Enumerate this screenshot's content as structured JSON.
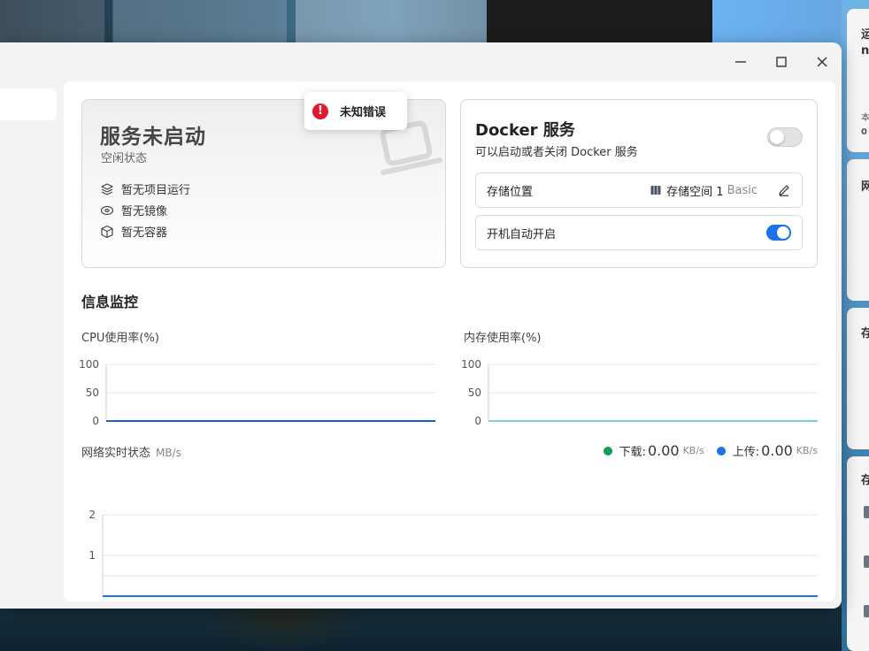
{
  "window": {
    "minimize_icon": "minimize-icon",
    "maximize_icon": "maximize-icon",
    "close_icon": "close-icon"
  },
  "toast": {
    "icon": "error-icon",
    "message": "未知错误",
    "color": "#e2192c"
  },
  "status_card": {
    "title": "服务未启动",
    "subtitle": "空闲状态",
    "items": [
      {
        "icon": "layers-icon",
        "label": "暂无项目运行"
      },
      {
        "icon": "disc-icon",
        "label": "暂无镜像"
      },
      {
        "icon": "box-icon",
        "label": "暂无容器"
      }
    ]
  },
  "docker_card": {
    "title": "Docker 服务",
    "subtitle": "可以启动或者关闭 Docker 服务",
    "service_enabled": false,
    "storage": {
      "label": "存储位置",
      "value": "存储空间 1",
      "tag": "Basic",
      "icon": "storage-icon",
      "edit_icon": "edit-icon"
    },
    "autostart": {
      "label": "开机自动开启",
      "enabled": true
    },
    "accent_color": "#1a73e8"
  },
  "monitor": {
    "title": "信息监控",
    "cpu_label": "CPU使用率(%)",
    "mem_label": "内存使用率(%)",
    "net_label": "网络实时状态",
    "net_unit": "MB/s",
    "download_label": "下载:",
    "download_value": "0.00",
    "download_unit": "KB/s",
    "upload_label": "上传:",
    "upload_value": "0.00",
    "upload_unit": "KB/s",
    "download_color": "#0f9d58",
    "upload_color": "#1a73e8"
  },
  "chart_data": [
    {
      "type": "line",
      "title": "CPU使用率(%)",
      "ylim": [
        0,
        100
      ],
      "yticks": [
        "100",
        "50",
        "0"
      ],
      "series": [
        {
          "values": [
            0,
            0,
            0,
            0,
            0,
            0,
            0,
            0,
            0,
            0
          ],
          "color": "#1a62c8"
        }
      ],
      "grid": true
    },
    {
      "type": "line",
      "title": "内存使用率(%)",
      "ylim": [
        0,
        100
      ],
      "yticks": [
        "100",
        "50",
        "0"
      ],
      "series": [
        {
          "values": [
            0,
            0,
            0,
            0,
            0,
            0,
            0,
            0,
            0,
            0
          ],
          "color": "#7fd0d6"
        }
      ],
      "grid": true
    },
    {
      "type": "line",
      "title": "网络实时状态",
      "ylim": [
        0,
        2
      ],
      "yticks": [
        "2",
        "1"
      ],
      "series": [
        {
          "name": "下载",
          "values": [
            0,
            0,
            0,
            0,
            0,
            0,
            0,
            0,
            0,
            0
          ],
          "color": "#0f9d58"
        },
        {
          "name": "上传",
          "values": [
            0,
            0,
            0,
            0,
            0,
            0,
            0,
            0,
            0,
            0
          ],
          "color": "#1a73e8"
        }
      ],
      "grid": true
    }
  ],
  "right_panel": {
    "widget1_line1": "运",
    "widget1_line2": "n",
    "widget1_small1": "本",
    "widget1_small2": "0",
    "widget2_title": "网",
    "widget3_title": "存",
    "widget4_title": "存"
  }
}
